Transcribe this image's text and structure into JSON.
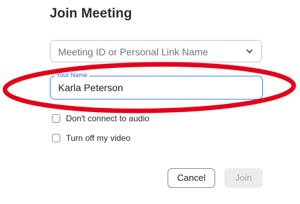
{
  "dialog": {
    "title": "Join Meeting"
  },
  "meeting_id": {
    "placeholder": "Meeting ID or Personal Link Name",
    "icon": "chevron-down-icon"
  },
  "your_name": {
    "label": "Your Name",
    "value": "Karla Peterson",
    "border_color": "#4a86e8"
  },
  "options": [
    {
      "label": "Don't connect to audio",
      "checked": false
    },
    {
      "label": "Turn off my video",
      "checked": false
    }
  ],
  "buttons": {
    "cancel_label": "Cancel",
    "join_label": "Join",
    "join_enabled": false
  },
  "annotation": {
    "shape": "ellipse",
    "color": "#e3001b",
    "target": "your-name-field"
  }
}
